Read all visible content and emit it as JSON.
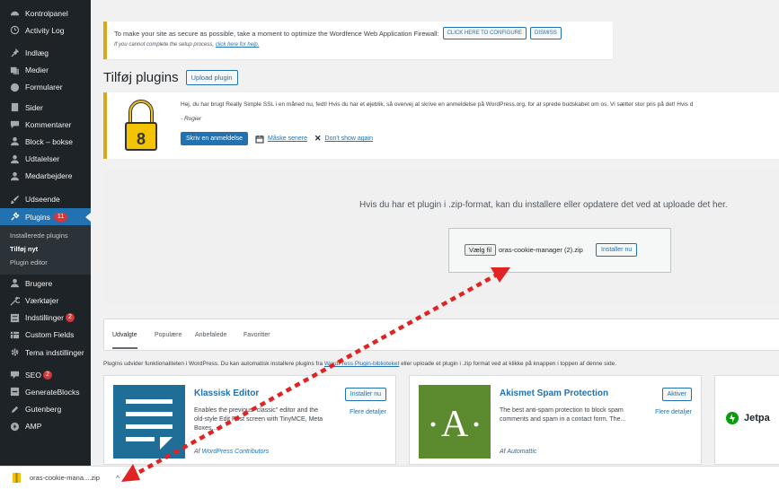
{
  "sidebar": {
    "items": [
      {
        "label": "Kontrolpanel",
        "icon": "dashboard-icon"
      },
      {
        "label": "Activity Log",
        "icon": "clock-icon"
      },
      {
        "label": "Indlæg",
        "icon": "pin-icon"
      },
      {
        "label": "Medier",
        "icon": "media-icon"
      },
      {
        "label": "Formularer",
        "icon": "forms-icon"
      },
      {
        "label": "Sider",
        "icon": "page-icon"
      },
      {
        "label": "Kommentarer",
        "icon": "comment-icon"
      },
      {
        "label": "Block – bokse",
        "icon": "person-icon"
      },
      {
        "label": "Udtalelser",
        "icon": "person-icon"
      },
      {
        "label": "Medarbejdere",
        "icon": "person-icon"
      },
      {
        "label": "Udseende",
        "icon": "brush-icon"
      },
      {
        "label": "Plugins",
        "icon": "plugin-icon",
        "badge": "11"
      },
      {
        "label": "Brugere",
        "icon": "users-icon"
      },
      {
        "label": "Værktøjer",
        "icon": "wrench-icon"
      },
      {
        "label": "Indstillinger",
        "icon": "settings-icon",
        "badge": "2"
      },
      {
        "label": "Custom Fields",
        "icon": "table-icon"
      },
      {
        "label": "Tema indstillinger",
        "icon": "gear-icon"
      },
      {
        "label": "SEO",
        "icon": "seo-icon",
        "badge": "2"
      },
      {
        "label": "GenerateBlocks",
        "icon": "blocks-icon"
      },
      {
        "label": "Gutenberg",
        "icon": "pen-icon"
      },
      {
        "label": "AMP",
        "icon": "amp-icon"
      }
    ],
    "submenu": [
      "Installerede plugins",
      "Tilføj nyt",
      "Plugin editor"
    ]
  },
  "wordfence": {
    "message": "To make your site as secure as possible, take a moment to optimize the Wordfence Web Application Firewall:",
    "configure_label": "CLICK HERE TO CONFIGURE",
    "dismiss_label": "DISMISS",
    "sub_text": "If you cannot complete the setup process,",
    "sub_link": "click here for help."
  },
  "page": {
    "title": "Tilføj plugins",
    "upload_button": "Upload plugin"
  },
  "ssl_notice": {
    "text": "Hej, du har brugt Really Simple SSL i en måned nu, fedt! Hvis du har et øjeblik, så overvej at skrive en anmeldelse på WordPress.org, for at sprede budskabet om os. Vi sætter stor pris på det! Hvis d",
    "signature": "- Rogier",
    "review_button": "Skriv en anmeldelse",
    "maybe_later": "Måske senere",
    "dont_show": "Don't show again"
  },
  "upload": {
    "description": "Hvis du har et plugin i .zip-format, kan du installere eller opdatere det ved at uploade det her.",
    "choose_button": "Vælg fil",
    "file_name": "oras-cookie-manager (2).zip",
    "install_button": "Installer nu"
  },
  "tabs": [
    "Udvalgte",
    "Populære",
    "Anbefalede",
    "Favoritter"
  ],
  "info": {
    "before": "Plugins udvider funktionaliteten i WordPress. Du kan automatisk installere plugins fra ",
    "link": "WordPress Plugin-biblioteket",
    "after": " eller uploade et plugin i .zip format ved at klikke på knappen i toppen af denne side."
  },
  "cards": [
    {
      "title": "Klassisk Editor",
      "description": "Enables the previous \"classic\" editor and the old-style Edit Post screen with TinyMCE, Meta Boxes,...",
      "author_prefix": "Af",
      "author": "WordPress Contributors",
      "button": "Installer nu",
      "more": "Flere detaljer"
    },
    {
      "title": "Akismet Spam Protection",
      "description": "The best anti-spam protection to block spam comments and spam in a contact form. The...",
      "author_prefix": "Af",
      "author": "Automattic",
      "button": "Aktiver",
      "more": "Flere detaljer"
    },
    {
      "title": "Jetpa"
    }
  ],
  "download": {
    "file": "oras-cookie-mana....zip",
    "close": "^"
  },
  "colors": {
    "sidebar_bg": "#1d2327",
    "accent": "#2271b1",
    "badge": "#d63638",
    "arrow": "#e02424",
    "classic_editor_tile": "#1e6e98",
    "akismet_tile": "#5c8b2f"
  }
}
